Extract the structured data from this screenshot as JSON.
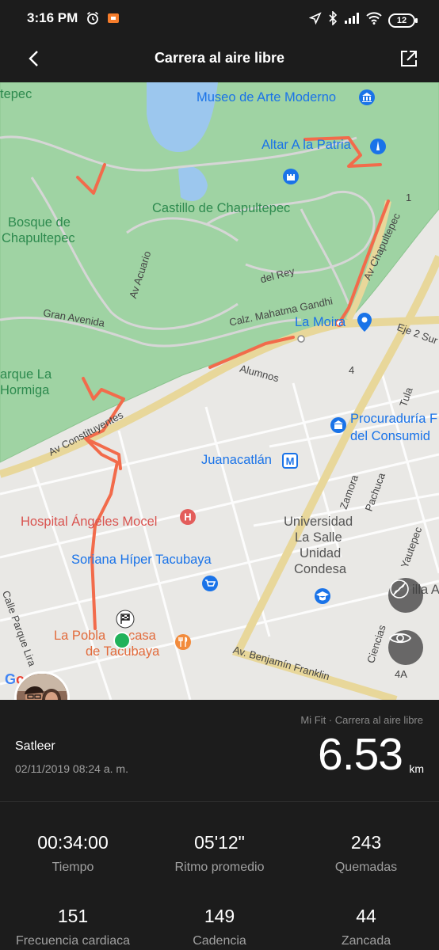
{
  "status_bar": {
    "time": "3:16 PM",
    "battery": "12",
    "icons": [
      "alarm-icon",
      "notification-icon",
      "location-icon",
      "bluetooth-icon",
      "signal-icon",
      "wifi-icon"
    ]
  },
  "header": {
    "title": "Carrera al aire libre",
    "back_icon": "back-arrow-icon",
    "share_icon": "share-icon"
  },
  "map": {
    "labels": {
      "museo": "Museo de Arte Moderno",
      "altar": "Altar A la Patria",
      "castillo": "Castillo de Chapultepec",
      "bosque1": "Bosque de",
      "bosque2": "Chapultepec",
      "tepec": "tepec",
      "parque1": "arque La",
      "parque2": "Hormiga",
      "la_moira": "La Moira",
      "procuraduria1": "Procuraduría F",
      "procuraduria2": "del Consumid",
      "juanacatlan": "Juanacatlán",
      "hospital": "Hospital Ángeles Mocel",
      "soriana": "Soriana Híper Tacubaya",
      "universidad1": "Universidad",
      "universidad2": "La Salle",
      "universidad3": "Unidad",
      "universidad4": "Condesa",
      "poblana1": "La Pobla",
      "poblana2": "casa",
      "poblana3": "de Tacubaya",
      "villa": "illa A"
    },
    "streets": {
      "acuario": "Av Acuario",
      "del_rey": "del Rey",
      "gran_avenida": "Gran Avenida",
      "mahatma": "Calz. Mahatma Gandhi",
      "alumnos": "Alumnos",
      "constituyentes": "Av Constituyentes",
      "chapultepec": "Av Chapultepec",
      "eje2": "Eje 2 Sur",
      "tula": "Tula",
      "zamora": "Zamora",
      "pachuca": "Pachuca",
      "yautepec": "Yautepec",
      "parque_lira": "Calle Parque Lira",
      "franklin": "Av. Benjamín Franklin",
      "ciencias": "Ciencias",
      "road4": "4",
      "road1": "1",
      "road4a": "4A"
    },
    "google": "Google",
    "buttons": [
      "hide-route-icon",
      "eye-icon"
    ]
  },
  "summary": {
    "source": "Mi Fit · Carrera al aire libre",
    "user": "Satleer",
    "date": "02/11/2019 08:24 a. m.",
    "distance": "6.53",
    "unit": "km"
  },
  "stats": [
    {
      "value": "00:34:00",
      "label": "Tiempo"
    },
    {
      "value": "05'12\"",
      "label": "Ritmo promedio"
    },
    {
      "value": "243",
      "label": "Quemadas"
    },
    {
      "value": "151",
      "label": "Frecuencia cardiaca"
    },
    {
      "value": "149",
      "label": "Cadencia"
    },
    {
      "value": "44",
      "label": "Zancada"
    }
  ],
  "colors": {
    "route": "#f26b4b",
    "park": "#9fd3a3",
    "major_road": "#e8d79a",
    "background": "#1c1c1c"
  }
}
